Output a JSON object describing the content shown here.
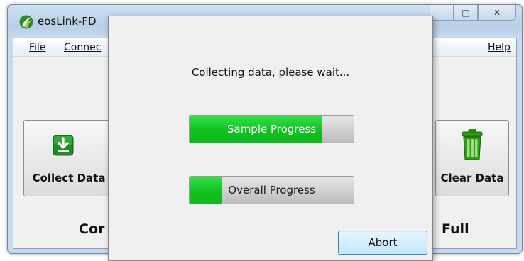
{
  "window": {
    "title": "eosLink-FD",
    "controls": {
      "minimize": "—",
      "maximize": "□",
      "close": "✕"
    }
  },
  "menu": {
    "file": "File",
    "connect": "Connec",
    "help": "Help"
  },
  "toolbar": {
    "collect_label": "Collect Data",
    "clear_label": "Clear Data"
  },
  "status": {
    "left": "Cor",
    "right": "Full"
  },
  "dialog": {
    "message": "Collecting data, please wait...",
    "sample_label": "Sample Progress",
    "sample_progress": 0.81,
    "overall_label": "Overall Progress",
    "overall_progress": 0.2,
    "abort_label": "Abort"
  },
  "colors": {
    "progress_fill": "#0fc21f",
    "trash_green": "#2f9a1c",
    "download_green": "#1e8a2a"
  },
  "icons": {
    "logo": "eos-leaf-logo",
    "collect": "download-arrow-icon",
    "clear": "trash-can-icon"
  }
}
